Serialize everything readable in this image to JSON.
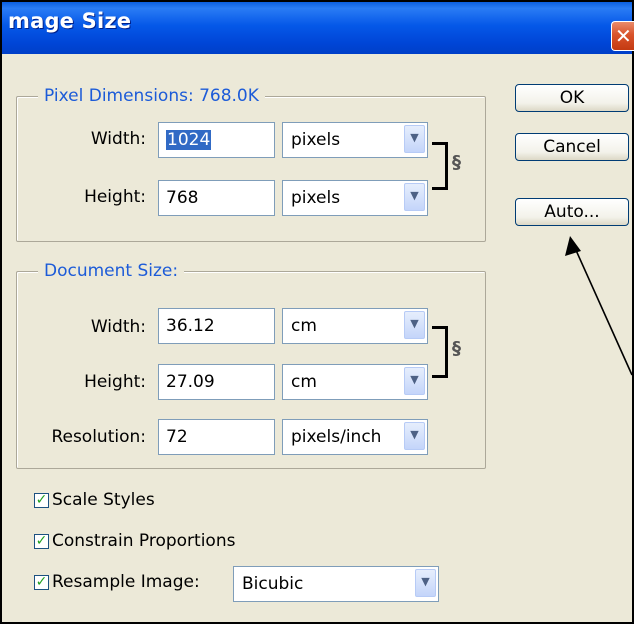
{
  "title": "mage Size",
  "buttons": {
    "ok": "OK",
    "cancel": "Cancel",
    "auto": "Auto..."
  },
  "pixel_dimensions": {
    "legend": "Pixel Dimensions:  768.0K",
    "width_label": "Width:",
    "width_value": "1024",
    "width_unit": "pixels",
    "height_label": "Height:",
    "height_value": "768",
    "height_unit": "pixels"
  },
  "document_size": {
    "legend": "Document Size:",
    "width_label": "Width:",
    "width_value": "36.12",
    "width_unit": "cm",
    "height_label": "Height:",
    "height_value": "27.09",
    "height_unit": "cm",
    "resolution_label": "Resolution:",
    "resolution_value": "72",
    "resolution_unit": "pixels/inch"
  },
  "options": {
    "scale_styles": "Scale Styles",
    "scale_styles_checked": true,
    "constrain_proportions": "Constrain Proportions",
    "constrain_proportions_checked": true,
    "resample_image": "Resample Image:",
    "resample_image_checked": true,
    "resample_method": "Bicubic"
  },
  "icons": {
    "close": "close-icon",
    "link": "chain-link-icon",
    "dropdown": "chevron-down-icon",
    "check": "checkmark-icon"
  },
  "colors": {
    "titlebar": "#0558e8",
    "legend_text": "#1c5bd8",
    "dialog_bg": "#ece9d8",
    "close_button": "#d9532b"
  }
}
